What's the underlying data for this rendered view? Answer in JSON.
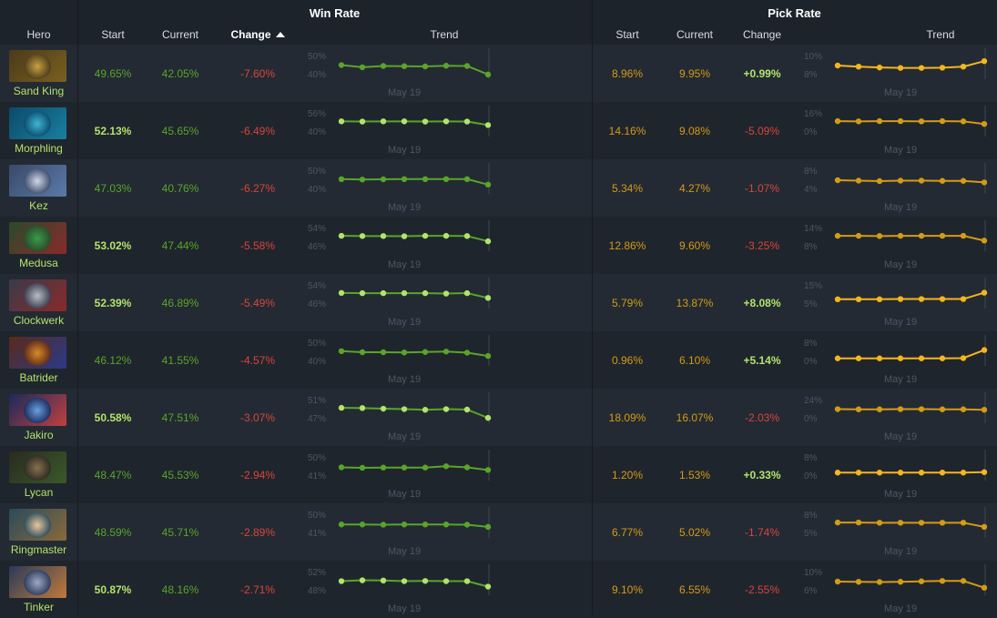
{
  "headers": {
    "win_rate": "Win Rate",
    "pick_rate": "Pick Rate",
    "hero": "Hero",
    "start": "Start",
    "current": "Current",
    "change": "Change",
    "trend": "Trend"
  },
  "colors": {
    "win_green": "#59a52a",
    "win_green_light": "#b3e36b",
    "pick_orange": "#d49b16",
    "pick_orange_light": "#f5b51f",
    "negative_red": "#d8453c",
    "positive_green": "#b3e36b",
    "trend_label": "#4c5766"
  },
  "heroes": [
    {
      "name": "Sand King",
      "win": {
        "start": "49.65%",
        "current": "42.05%",
        "change": "-7.60%",
        "hi": "50%",
        "lo": "40%",
        "date": "May 19",
        "pts": [
          52,
          42,
          48,
          47,
          46,
          49,
          48,
          9
        ]
      },
      "pick": {
        "start": "8.96%",
        "current": "9.95%",
        "change": "+0.99%",
        "hi": "10%",
        "lo": "8%",
        "date": "May 19",
        "pts": [
          50,
          45,
          41,
          39,
          39,
          40,
          45,
          70
        ]
      },
      "bold_win": false
    },
    {
      "name": "Morphling",
      "win": {
        "start": "52.13%",
        "current": "45.65%",
        "change": "-6.49%",
        "hi": "56%",
        "lo": "40%",
        "date": "May 19",
        "pts": [
          57,
          56,
          57,
          57,
          56,
          57,
          56,
          40
        ]
      },
      "pick": {
        "start": "14.16%",
        "current": "9.08%",
        "change": "-5.09%",
        "hi": "16%",
        "lo": "0%",
        "date": "May 19",
        "pts": [
          58,
          57,
          58,
          58,
          57,
          58,
          57,
          45
        ]
      },
      "bold_win": true
    },
    {
      "name": "Kez",
      "win": {
        "start": "47.03%",
        "current": "40.76%",
        "change": "-6.27%",
        "hi": "50%",
        "lo": "40%",
        "date": "May 19",
        "pts": [
          55,
          53,
          54,
          55,
          55,
          55,
          55,
          30
        ]
      },
      "pick": {
        "start": "5.34%",
        "current": "4.27%",
        "change": "-1.07%",
        "hi": "8%",
        "lo": "4%",
        "date": "May 19",
        "pts": [
          50,
          48,
          46,
          48,
          48,
          47,
          47,
          40
        ]
      },
      "bold_win": false
    },
    {
      "name": "Medusa",
      "win": {
        "start": "53.02%",
        "current": "47.44%",
        "change": "-5.58%",
        "hi": "54%",
        "lo": "46%",
        "date": "May 19",
        "pts": [
          58,
          57,
          57,
          56,
          58,
          58,
          57,
          33
        ]
      },
      "pick": {
        "start": "12.86%",
        "current": "9.60%",
        "change": "-3.25%",
        "hi": "14%",
        "lo": "8%",
        "date": "May 19",
        "pts": [
          58,
          58,
          57,
          58,
          58,
          58,
          58,
          36
        ]
      },
      "bold_win": true
    },
    {
      "name": "Clockwerk",
      "win": {
        "start": "52.39%",
        "current": "46.89%",
        "change": "-5.49%",
        "hi": "54%",
        "lo": "46%",
        "date": "May 19",
        "pts": [
          59,
          58,
          58,
          58,
          58,
          56,
          58,
          36
        ]
      },
      "pick": {
        "start": "5.79%",
        "current": "13.87%",
        "change": "+8.08%",
        "hi": "15%",
        "lo": "5%",
        "date": "May 19",
        "pts": [
          30,
          30,
          30,
          31,
          31,
          31,
          31,
          60
        ]
      },
      "bold_win": true
    },
    {
      "name": "Batrider",
      "win": {
        "start": "46.12%",
        "current": "41.55%",
        "change": "-4.57%",
        "hi": "50%",
        "lo": "40%",
        "date": "May 19",
        "pts": [
          55,
          50,
          50,
          49,
          51,
          53,
          48,
          33
        ]
      },
      "pick": {
        "start": "0.96%",
        "current": "6.10%",
        "change": "+5.14%",
        "hi": "8%",
        "lo": "0%",
        "date": "May 19",
        "pts": [
          22,
          22,
          22,
          22,
          22,
          22,
          23,
          60
        ]
      },
      "bold_win": false
    },
    {
      "name": "Jakiro",
      "win": {
        "start": "50.58%",
        "current": "47.51%",
        "change": "-3.07%",
        "hi": "51%",
        "lo": "47%",
        "date": "May 19",
        "pts": [
          58,
          57,
          54,
          52,
          49,
          52,
          50,
          12
        ]
      },
      "pick": {
        "start": "18.09%",
        "current": "16.07%",
        "change": "-2.03%",
        "hi": "24%",
        "lo": "0%",
        "date": "May 19",
        "pts": [
          52,
          51,
          51,
          52,
          52,
          51,
          51,
          49
        ]
      },
      "bold_win": true
    },
    {
      "name": "Lycan",
      "win": {
        "start": "48.47%",
        "current": "45.53%",
        "change": "-2.94%",
        "hi": "50%",
        "lo": "41%",
        "date": "May 19",
        "pts": [
          48,
          46,
          47,
          47,
          47,
          53,
          48,
          36
        ]
      },
      "pick": {
        "start": "1.20%",
        "current": "1.53%",
        "change": "+0.33%",
        "hi": "8%",
        "lo": "0%",
        "date": "May 19",
        "pts": [
          24,
          24,
          24,
          24,
          24,
          24,
          24,
          26
        ]
      },
      "bold_win": false
    },
    {
      "name": "Ringmaster",
      "win": {
        "start": "48.59%",
        "current": "45.71%",
        "change": "-2.89%",
        "hi": "50%",
        "lo": "41%",
        "date": "May 19",
        "pts": [
          49,
          49,
          48,
          49,
          49,
          49,
          48,
          38
        ]
      },
      "pick": {
        "start": "6.77%",
        "current": "5.02%",
        "change": "-1.74%",
        "hi": "8%",
        "lo": "5%",
        "date": "May 19",
        "pts": [
          58,
          58,
          57,
          57,
          57,
          57,
          57,
          38
        ]
      },
      "bold_win": false
    },
    {
      "name": "Tinker",
      "win": {
        "start": "50.87%",
        "current": "48.16%",
        "change": "-2.71%",
        "hi": "52%",
        "lo": "48%",
        "date": "May 19",
        "pts": [
          52,
          56,
          55,
          52,
          53,
          52,
          52,
          27
        ]
      },
      "pick": {
        "start": "9.10%",
        "current": "6.55%",
        "change": "-2.55%",
        "hi": "10%",
        "lo": "6%",
        "date": "May 19",
        "pts": [
          50,
          49,
          48,
          49,
          51,
          53,
          53,
          22
        ]
      },
      "bold_win": true
    }
  ]
}
